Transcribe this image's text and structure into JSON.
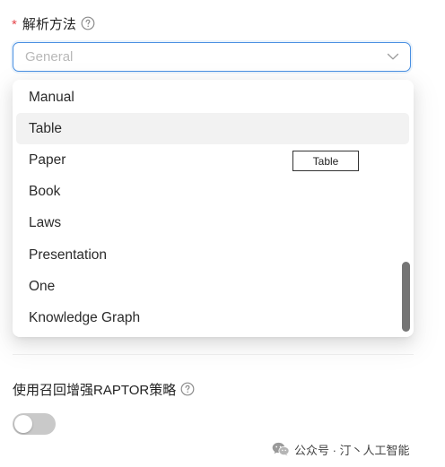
{
  "form": {
    "parse_method": {
      "required_mark": "*",
      "label": "解析方法",
      "help_icon": "question-circle-icon",
      "select_placeholder": "General",
      "chevron_icon": "chevron-down-icon"
    },
    "raptor": {
      "label": "使用召回增强RAPTOR策略",
      "help_icon": "question-circle-icon",
      "toggle_on": false
    }
  },
  "dropdown": {
    "options": [
      "Manual",
      "Table",
      "Paper",
      "Book",
      "Laws",
      "Presentation",
      "One",
      "Knowledge Graph"
    ],
    "hovered_option": "Table",
    "tooltip": "Table"
  },
  "watermark": {
    "icon": "wechat-icon",
    "text": "公众号 · 汀丶人工智能"
  },
  "colors": {
    "accent": "#4a90e2",
    "required": "#e5484d",
    "toggle_off": "#c9c9c9",
    "hover_bg": "#f2f2f2",
    "placeholder": "#b8b8b8"
  }
}
